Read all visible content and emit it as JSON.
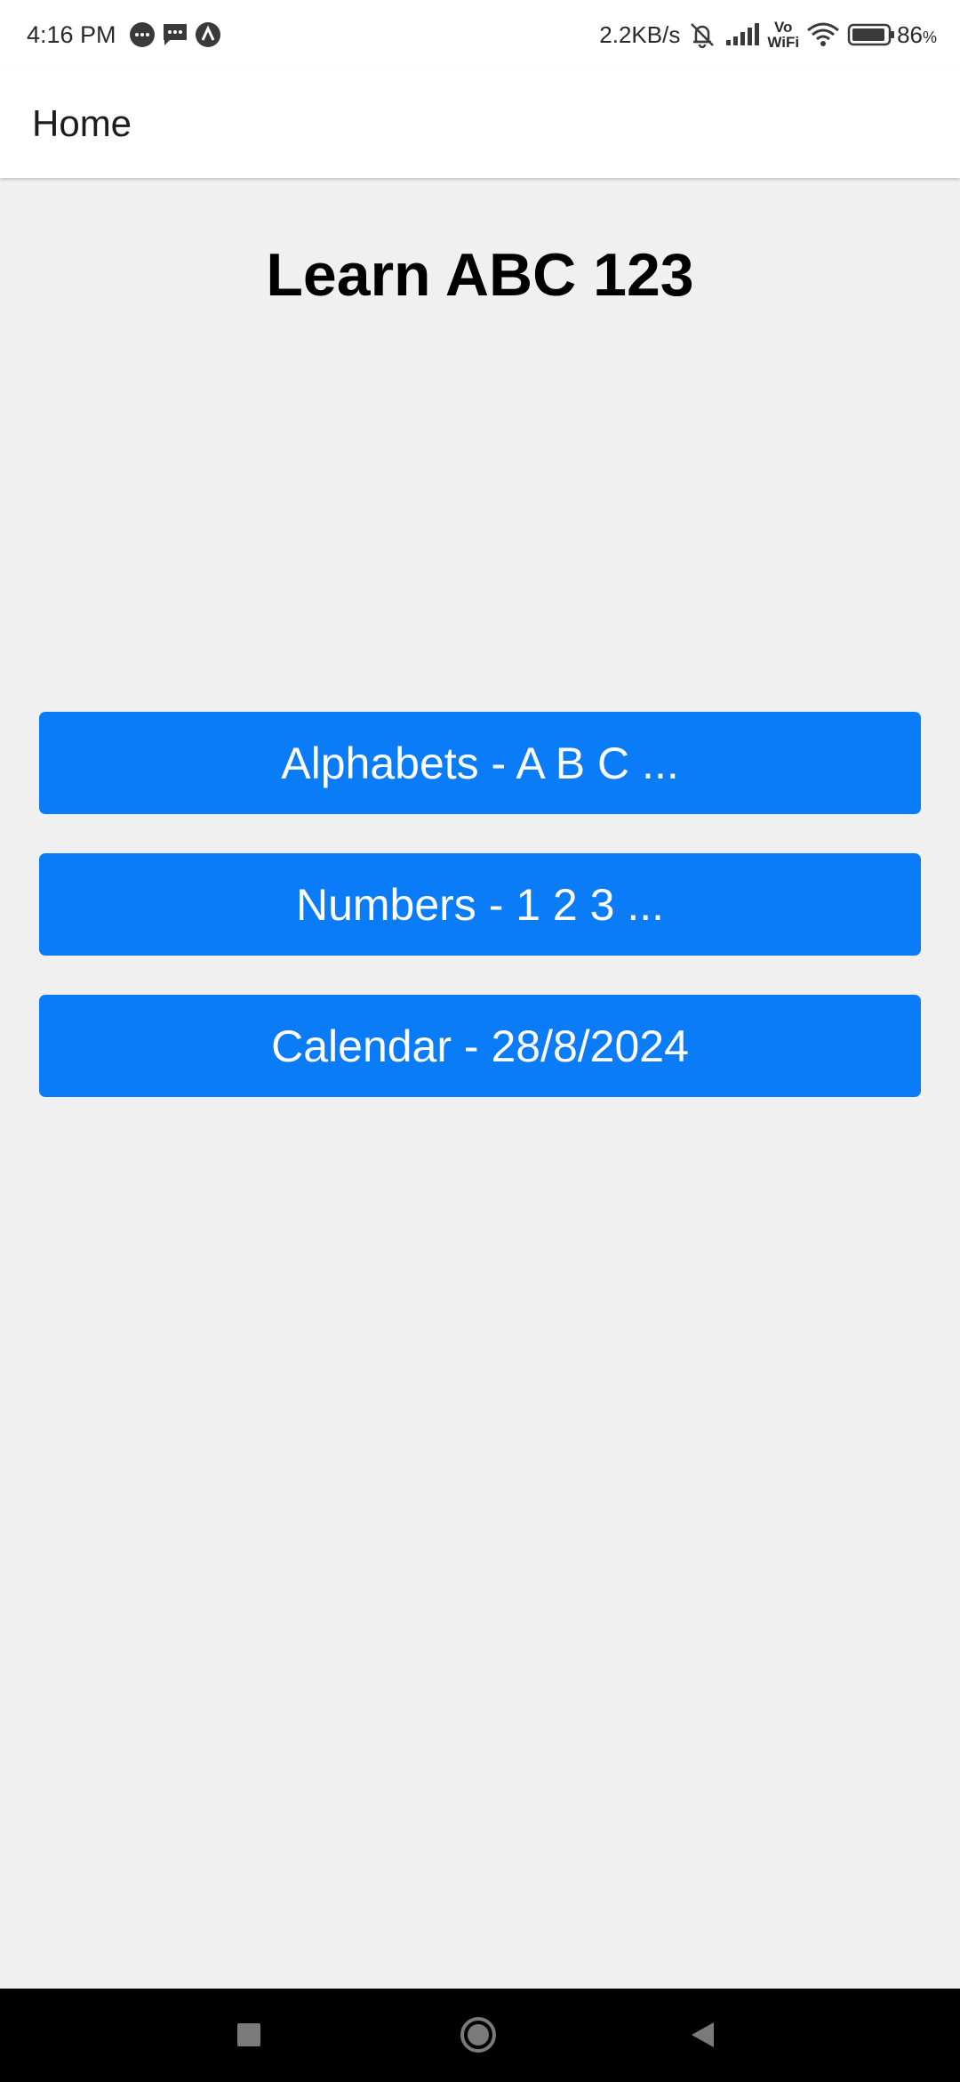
{
  "status_bar": {
    "time": "4:16 PM",
    "net_speed": "2.2KB/s",
    "battery_percent": "86",
    "battery_unit": "%",
    "notification_icons": [
      "chat-bubble-icon",
      "message-icon",
      "app-a-icon"
    ],
    "system_icons": [
      "mute-icon",
      "signal-icon",
      "vowifi-icon",
      "wifi-icon",
      "battery-icon"
    ],
    "vowifi_top": "Vo",
    "vowifi_bottom": "WiFi"
  },
  "app_bar": {
    "title": "Home"
  },
  "main": {
    "title": "Learn ABC 123",
    "buttons": [
      {
        "label": "Alphabets - A B C ..."
      },
      {
        "label": "Numbers - 1 2 3 ..."
      },
      {
        "label": "Calendar - 28/8/2024"
      }
    ]
  },
  "nav_bar": {
    "icons": [
      "recent-apps-icon",
      "home-icon",
      "back-icon"
    ]
  },
  "colors": {
    "accent": "#0a7cf8",
    "background": "#f0f0f1",
    "appbar": "#ffffff",
    "navbar": "#000000"
  }
}
